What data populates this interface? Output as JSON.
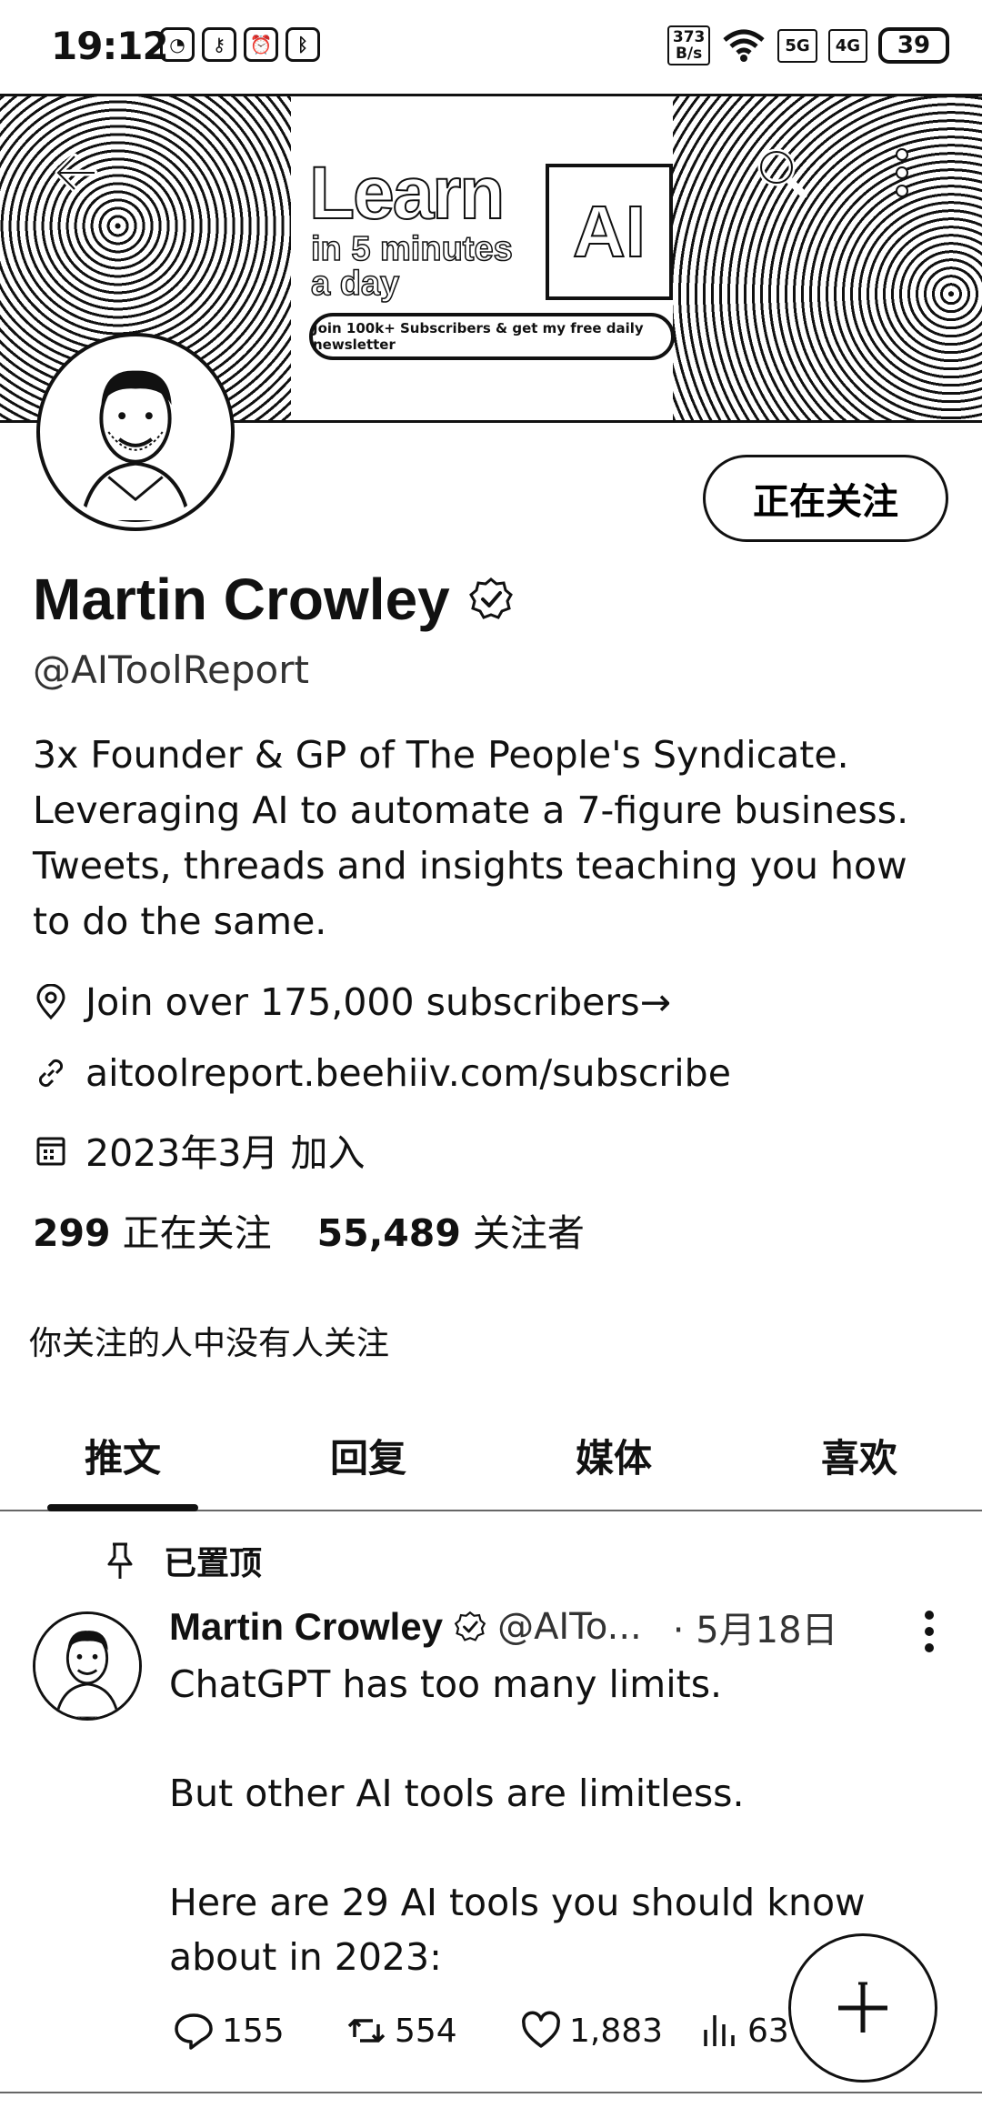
{
  "status_bar": {
    "time": "19:12",
    "net_speed": "373\nB/s",
    "signal1": "5G",
    "signal2": "4G",
    "battery": "39"
  },
  "banner": {
    "headline": "Learn",
    "line2": "in 5 minutes",
    "line3": "a day",
    "badge": "AI",
    "pill_text": "Join 100k+ Subscribers & get my free daily newsletter"
  },
  "profile": {
    "name": "Martin Crowley",
    "handle": "@AIToolReport",
    "follow_button": "正在关注",
    "bio": "3x Founder & GP of The People's Syndicate. Leveraging AI to automate a 7-figure business. Tweets, threads and insights teaching you how to do the same.",
    "location": "Join over 175,000 subscribers→",
    "link": "aitoolreport.beehiiv.com/subscribe",
    "joined": "2023年3月 加入",
    "following_count": "299",
    "following_label": "正在关注",
    "followers_count": "55,489",
    "followers_label": "关注者",
    "followed_by": "你关注的人中没有人关注"
  },
  "tabs": [
    {
      "label": "推文",
      "active": true
    },
    {
      "label": "回复",
      "active": false
    },
    {
      "label": "媒体",
      "active": false
    },
    {
      "label": "喜欢",
      "active": false
    }
  ],
  "tweet": {
    "pinned_label": "已置顶",
    "author": "Martin Crowley",
    "handle": "@AITo...",
    "date": "· 5月18日",
    "text_lines": [
      "ChatGPT has too many limits.",
      "",
      "But other AI tools are limitless.",
      "",
      "Here are 29 AI tools you should know about in 2023:"
    ],
    "replies": "155",
    "retweets": "554",
    "likes": "1,883",
    "views": "63"
  }
}
